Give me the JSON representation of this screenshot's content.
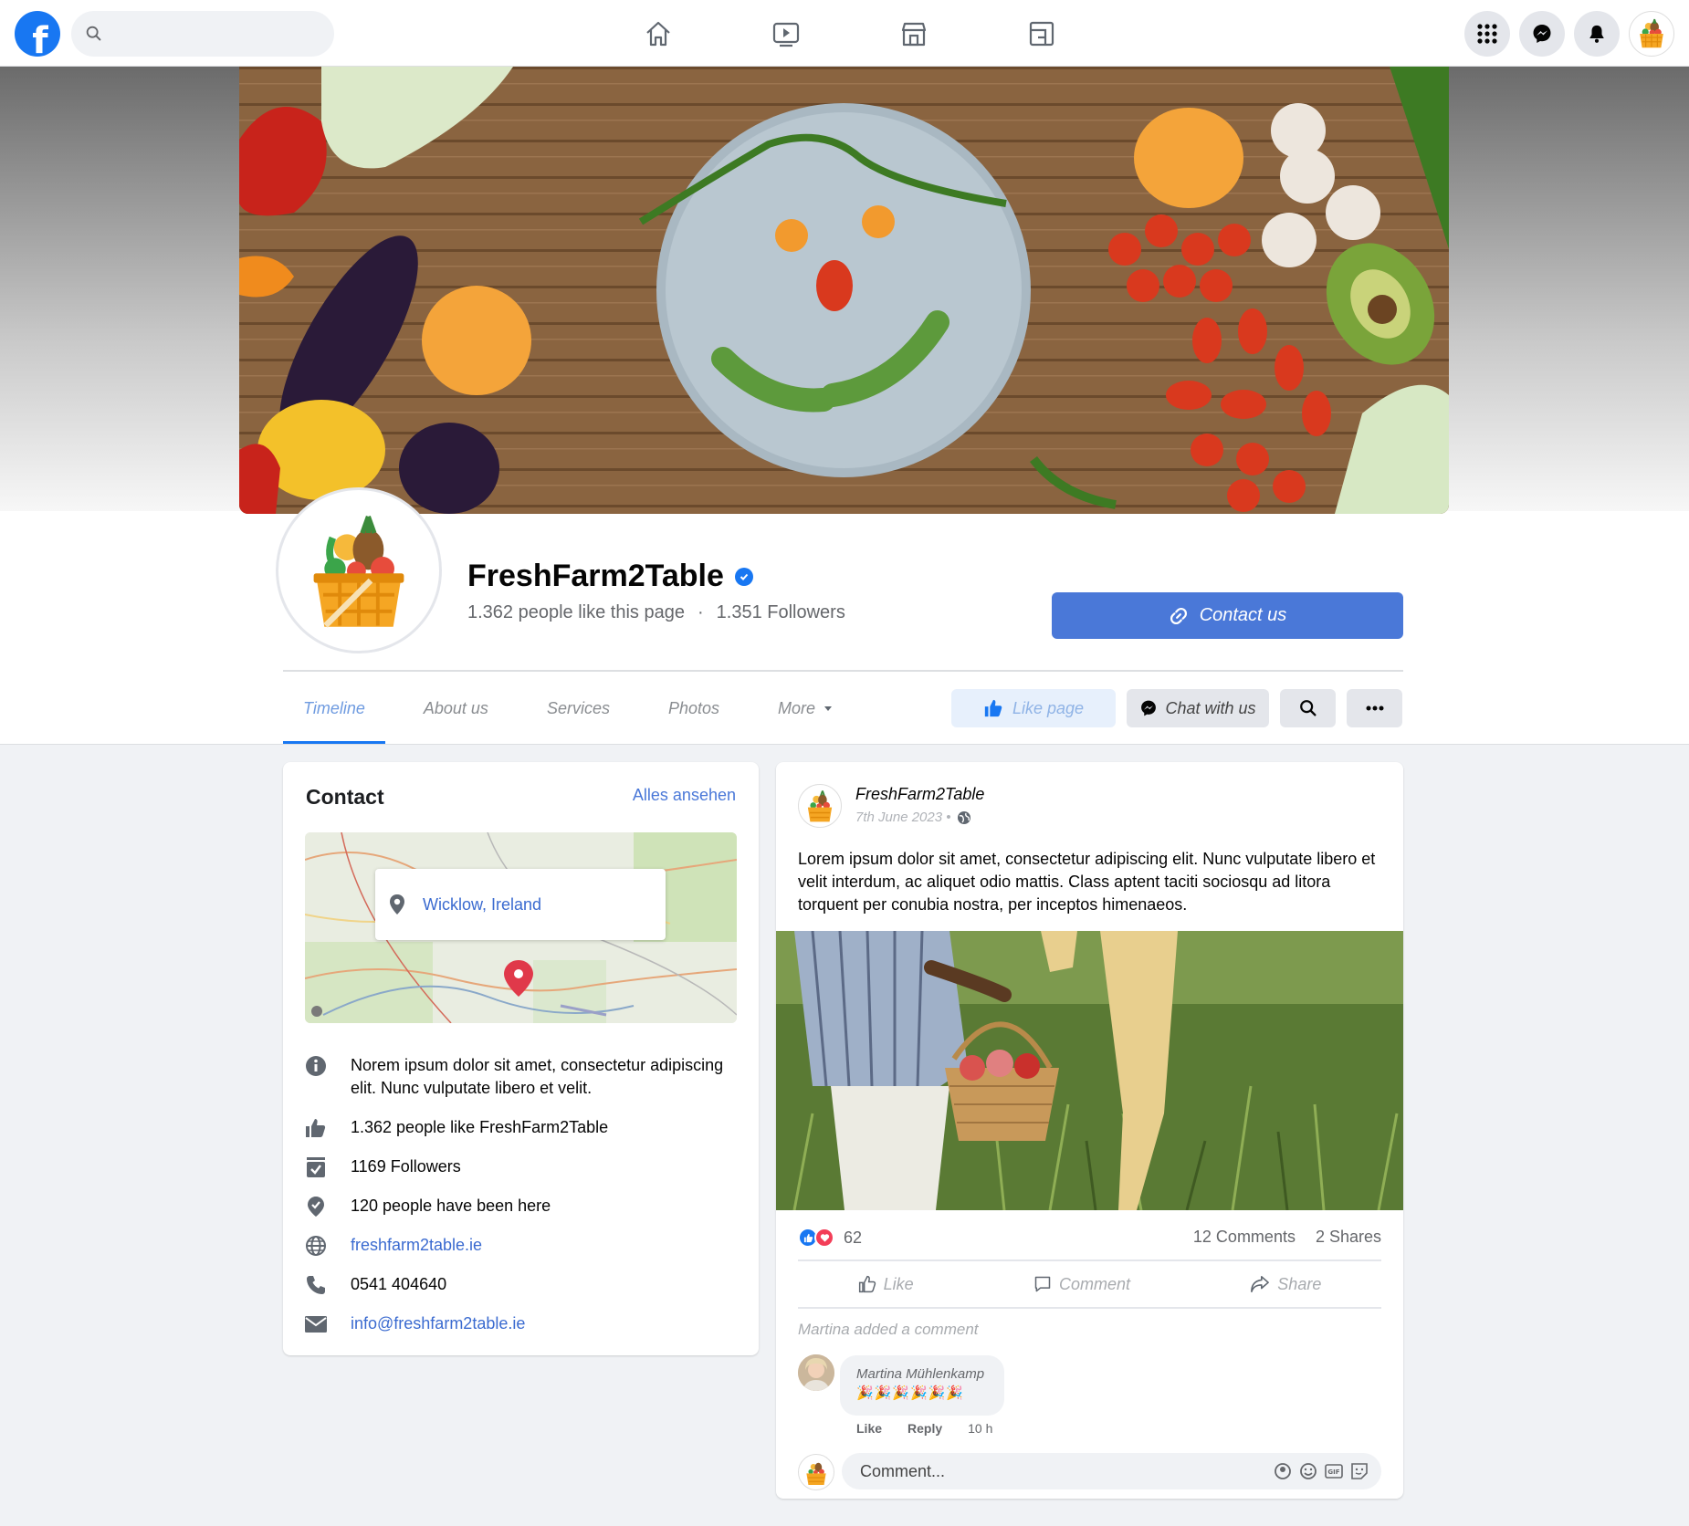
{
  "topnav": {
    "search_placeholder": "",
    "logo_letter": "f"
  },
  "page": {
    "name": "FreshFarm2Table",
    "likes": "1.362 people like this page",
    "separator": "·",
    "followers": "1.351 Followers",
    "contact_button": "Contact us"
  },
  "tabs": [
    "Timeline",
    "About us",
    "Services",
    "Photos",
    "More"
  ],
  "actions": {
    "like_page": "Like page",
    "chat": "Chat with us"
  },
  "contact": {
    "title": "Contact",
    "see_all": "Alles ansehen",
    "map_location": "Wicklow, Ireland",
    "about": "Norem ipsum dolor sit amet, consectetur adipiscing elit. Nunc vulputate libero et velit.",
    "likes": "1.362 people like FreshFarm2Table",
    "followers": "1169 Followers",
    "checkins": "120 people have been here",
    "website": "freshfarm2table.ie",
    "phone": "0541 404640",
    "email": "info@freshfarm2table.ie"
  },
  "post": {
    "author": "FreshFarm2Table",
    "date": "7th June  2023 •",
    "text": "Lorem ipsum dolor sit amet, consectetur adipiscing elit. Nunc vulputate libero et velit interdum, ac aliquet odio mattis. Class aptent taciti sociosqu ad litora torquent per conubia nostra, per inceptos himenaeos.",
    "reaction_count": "62",
    "comments": "12 Comments",
    "shares": "2 Shares",
    "like": "Like",
    "comment": "Comment",
    "share": "Share",
    "added_comment": "Martina added a comment",
    "commenter": "Martina Mühlenkamp",
    "comment_text": "🎉🎉🎉🎉🎉🎉",
    "cm_like": "Like",
    "cm_reply": "Reply",
    "cm_time": "10 h",
    "comment_placeholder": "Comment..."
  },
  "colors": {
    "brand": "#1877f2",
    "contact_button": "#4a78d8",
    "link": "#3b6bd0"
  }
}
